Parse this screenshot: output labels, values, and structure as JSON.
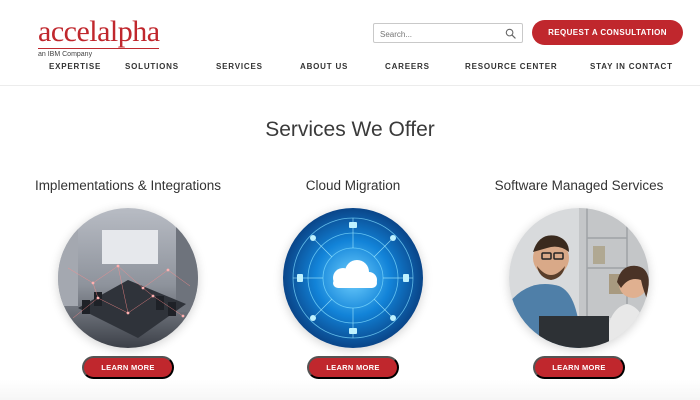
{
  "logo": {
    "name": "accelalpha",
    "tagline": "an IBM Company"
  },
  "search": {
    "placeholder": "Search..."
  },
  "cta": {
    "label": "REQUEST A CONSULTATION"
  },
  "nav": {
    "items": [
      "EXPERTISE",
      "SOLUTIONS",
      "SERVICES",
      "ABOUT US",
      "CAREERS",
      "RESOURCE CENTER",
      "STAY IN CONTACT"
    ]
  },
  "section": {
    "title": "Services We Offer",
    "cards": [
      {
        "title": "Implementations & Integrations",
        "button": "LEARN MORE",
        "image": "conference-room-network"
      },
      {
        "title": "Cloud Migration",
        "button": "LEARN MORE",
        "image": "cloud-circuit"
      },
      {
        "title": "Software Managed Services",
        "button": "LEARN MORE",
        "image": "office-colleagues"
      }
    ]
  },
  "colors": {
    "brand_red": "#c0272d",
    "text_dark": "#333333",
    "cloud_blue": "#0a6fc2"
  }
}
